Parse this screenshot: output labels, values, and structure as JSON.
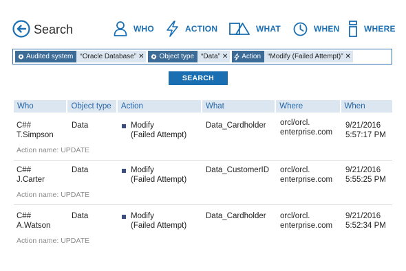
{
  "header": {
    "title": "Search",
    "nav": [
      {
        "key": "who",
        "label": "WHO",
        "icon": "person-icon"
      },
      {
        "key": "action",
        "label": "ACTION",
        "icon": "lightning-icon"
      },
      {
        "key": "what",
        "label": "WHAT",
        "icon": "shapes-icon"
      },
      {
        "key": "when",
        "label": "WHEN",
        "icon": "clock-icon"
      },
      {
        "key": "where",
        "label": "WHERE",
        "icon": "server-icon"
      }
    ]
  },
  "filters": [
    {
      "key": "Audited system",
      "value": "“Oracle Database”",
      "icon": "gear-icon"
    },
    {
      "key": "Object type",
      "value": "“Data”",
      "icon": "gear-icon"
    },
    {
      "key": "Action",
      "value": "“Modify (Failed Attempt)”",
      "icon": "lightning-icon"
    }
  ],
  "search_button": "SEARCH",
  "table": {
    "columns": [
      "Who",
      "Object type",
      "Action",
      "What",
      "Where",
      "When"
    ],
    "rows": [
      {
        "who_1": "C##",
        "who_2": "T.Simpson",
        "object_type": "Data",
        "action_1": "Modify",
        "action_2": "(Failed Attempt)",
        "what": "Data_Cardholder",
        "where_1": "orcl/orcl.",
        "where_2": "enterprise.com",
        "when_1": "9/21/2016",
        "when_2": "5:57:17 PM",
        "action_name": "Action name: UPDATE"
      },
      {
        "who_1": "C##",
        "who_2": "J.Carter",
        "object_type": "Data",
        "action_1": "Modify",
        "action_2": "(Failed Attempt)",
        "what": "Data_CustomerID",
        "where_1": "orcl/orcl.",
        "where_2": "enterprise.com",
        "when_1": "9/21/2016",
        "when_2": "5:55:25 PM",
        "action_name": "Action name: UPDATE"
      },
      {
        "who_1": "C##",
        "who_2": "A.Watson",
        "object_type": "Data",
        "action_1": "Modify",
        "action_2": "(Failed Attempt)",
        "what": "Data_Cardholder",
        "where_1": "orcl/orcl.",
        "where_2": "enterprise.com",
        "when_1": "9/21/2016",
        "when_2": "5:52:34 PM",
        "action_name": "Action name: UPDATE"
      }
    ]
  },
  "colors": {
    "accent": "#1a6fb3",
    "chip_key_bg": "#3b6b97",
    "chip_value_bg": "#dbe6f1",
    "header_bg": "#dbe6f1",
    "action_marker": "#3b4f82"
  }
}
